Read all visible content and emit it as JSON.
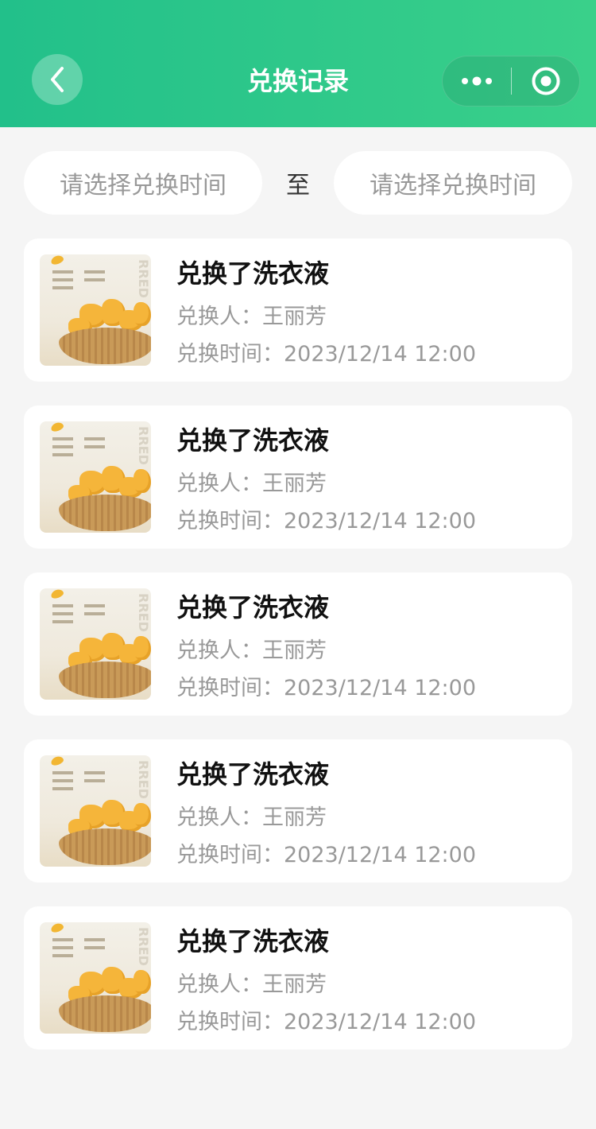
{
  "nav": {
    "title": "兑换记录"
  },
  "filter": {
    "start_placeholder": "请选择兑换时间",
    "to_label": "至",
    "end_placeholder": "请选择兑换时间"
  },
  "records": [
    {
      "title": "兑换了洗衣液",
      "person_label": "兑换人：",
      "person": "王丽芳",
      "time_label": "兑换时间：",
      "time": "2023/12/14 12:00"
    },
    {
      "title": "兑换了洗衣液",
      "person_label": "兑换人：",
      "person": "王丽芳",
      "time_label": "兑换时间：",
      "time": "2023/12/14 12:00"
    },
    {
      "title": "兑换了洗衣液",
      "person_label": "兑换人：",
      "person": "王丽芳",
      "time_label": "兑换时间：",
      "time": "2023/12/14 12:00"
    },
    {
      "title": "兑换了洗衣液",
      "person_label": "兑换人：",
      "person": "王丽芳",
      "time_label": "兑换时间：",
      "time": "2023/12/14 12:00"
    },
    {
      "title": "兑换了洗衣液",
      "person_label": "兑换人：",
      "person": "王丽芳",
      "time_label": "兑换时间：",
      "time": "2023/12/14 12:00"
    }
  ],
  "theme": {
    "header_gradient_start": "#22c08a",
    "header_gradient_end": "#3ad08a",
    "background": "#f5f5f5",
    "muted_text": "#999999"
  },
  "icons": {
    "back": "chevron-left-icon",
    "more": "more-dots-icon",
    "close": "target-circle-icon"
  }
}
